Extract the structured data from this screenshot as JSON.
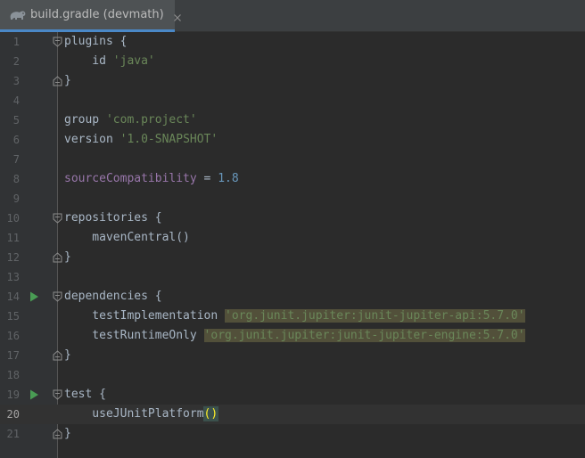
{
  "tab": {
    "title": "build.gradle (devmath)",
    "icon": "gradle-elephant-icon"
  },
  "colors": {
    "accent": "#4a88c7",
    "string": "#6a8759",
    "property": "#9876aa",
    "number": "#6897bb",
    "run": "#499c54"
  },
  "lines": [
    {
      "n": "1",
      "segments": [
        {
          "t": "plugins {",
          "c": "kw"
        }
      ]
    },
    {
      "n": "2",
      "segments": [
        {
          "t": "    id ",
          "c": "kw"
        },
        {
          "t": "'java'",
          "c": "str"
        }
      ]
    },
    {
      "n": "3",
      "segments": [
        {
          "t": "}",
          "c": "kw"
        }
      ]
    },
    {
      "n": "4",
      "segments": []
    },
    {
      "n": "5",
      "segments": [
        {
          "t": "group ",
          "c": "kw"
        },
        {
          "t": "'com.project'",
          "c": "str"
        }
      ]
    },
    {
      "n": "6",
      "segments": [
        {
          "t": "version ",
          "c": "kw"
        },
        {
          "t": "'1.0-SNAPSHOT'",
          "c": "str"
        }
      ]
    },
    {
      "n": "7",
      "segments": []
    },
    {
      "n": "8",
      "segments": [
        {
          "t": "sourceCompatibility",
          "c": "prop"
        },
        {
          "t": " = ",
          "c": "kw"
        },
        {
          "t": "1.8",
          "c": "num"
        }
      ]
    },
    {
      "n": "9",
      "segments": []
    },
    {
      "n": "10",
      "segments": [
        {
          "t": "repositories {",
          "c": "kw"
        }
      ]
    },
    {
      "n": "11",
      "segments": [
        {
          "t": "    mavenCentral()",
          "c": "kw"
        }
      ]
    },
    {
      "n": "12",
      "segments": [
        {
          "t": "}",
          "c": "kw"
        }
      ]
    },
    {
      "n": "13",
      "segments": []
    },
    {
      "n": "14",
      "segments": [
        {
          "t": "dependencies {",
          "c": "kw"
        }
      ]
    },
    {
      "n": "15",
      "segments": [
        {
          "t": "    testImplementation ",
          "c": "kw"
        },
        {
          "t": "'org.junit.jupiter:junit-jupiter-api:5.7.0'",
          "c": "hl-str"
        }
      ]
    },
    {
      "n": "16",
      "segments": [
        {
          "t": "    testRuntimeOnly ",
          "c": "kw"
        },
        {
          "t": "'org.junit.jupiter:junit-jupiter-engine:5.7.0'",
          "c": "hl-str"
        }
      ]
    },
    {
      "n": "17",
      "segments": [
        {
          "t": "}",
          "c": "kw"
        }
      ]
    },
    {
      "n": "18",
      "segments": []
    },
    {
      "n": "19",
      "segments": [
        {
          "t": "test {",
          "c": "kw"
        }
      ]
    },
    {
      "n": "20",
      "segments": [
        {
          "t": "    useJUnitPlatform",
          "c": "kw"
        },
        {
          "t": "(",
          "c": "paren-match"
        },
        {
          "t": ")",
          "c": "paren-match"
        }
      ]
    },
    {
      "n": "21",
      "segments": [
        {
          "t": "}",
          "c": "kw"
        }
      ]
    }
  ]
}
